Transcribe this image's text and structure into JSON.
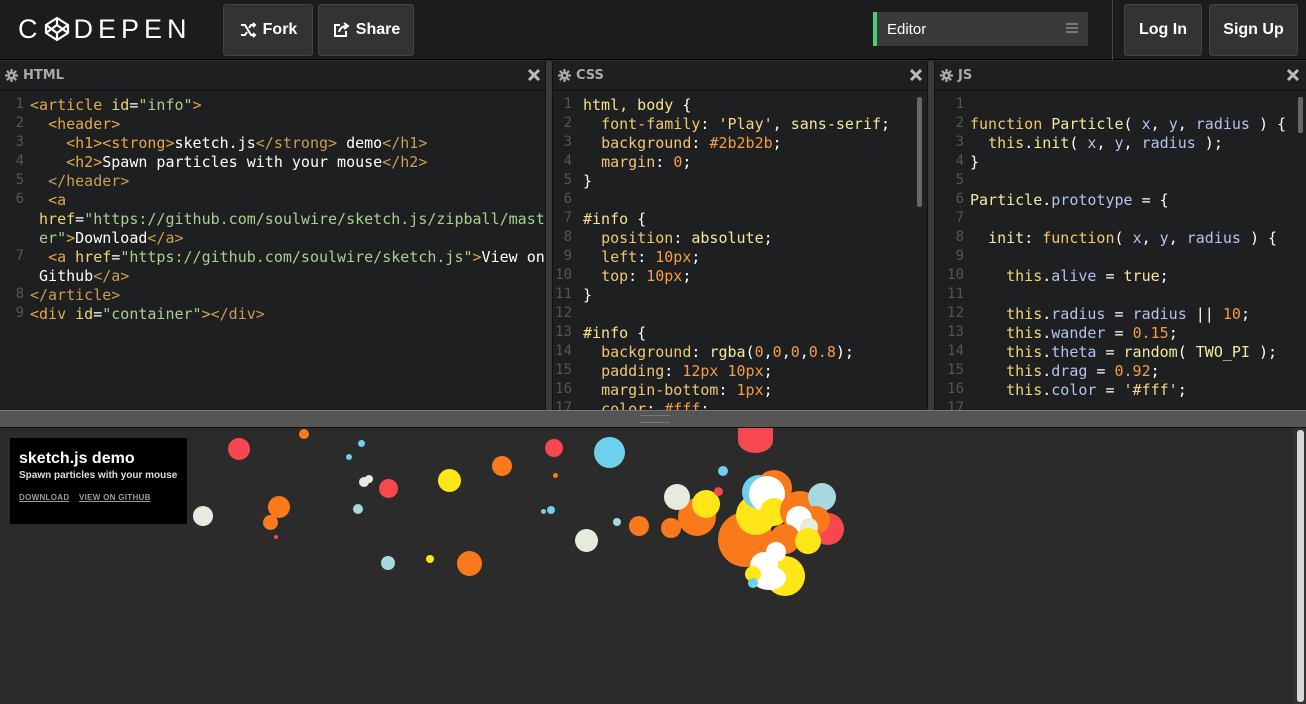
{
  "header": {
    "logo_text_left": "C",
    "logo_text_right": "DEPEN",
    "fork_label": "Fork",
    "share_label": "Share",
    "view_label": "Editor",
    "login_label": "Log In",
    "signup_label": "Sign Up"
  },
  "editors": {
    "html": {
      "title": "HTML",
      "line_numbers": [
        "1",
        "2",
        "3",
        "4",
        "5",
        "6",
        "",
        "7",
        "",
        "8",
        "9"
      ]
    },
    "css": {
      "title": "CSS",
      "line_numbers": [
        "1",
        "2",
        "3",
        "4",
        "5",
        "6",
        "7",
        "8",
        "9",
        "10",
        "11",
        "12",
        "13",
        "14",
        "15",
        "16",
        "17"
      ]
    },
    "js": {
      "title": "JS",
      "line_numbers": [
        "1",
        "2",
        "3",
        "4",
        "5",
        "6",
        "7",
        "8",
        "9",
        "10",
        "11",
        "12",
        "13",
        "14",
        "15",
        "16",
        "17"
      ]
    }
  },
  "preview": {
    "title": "sketch.js demo",
    "subtitle": "Spawn particles with your mouse",
    "download_label": "DOWNLOAD",
    "github_label": "VIEW ON GITHUB"
  },
  "colors": {
    "accent": "#47cf73",
    "particles": [
      "#f7474f",
      "#fa7a1b",
      "#ffe619",
      "#6fd0eb",
      "#e6ecdd",
      "#ffffff",
      "#a6d8e0"
    ]
  }
}
